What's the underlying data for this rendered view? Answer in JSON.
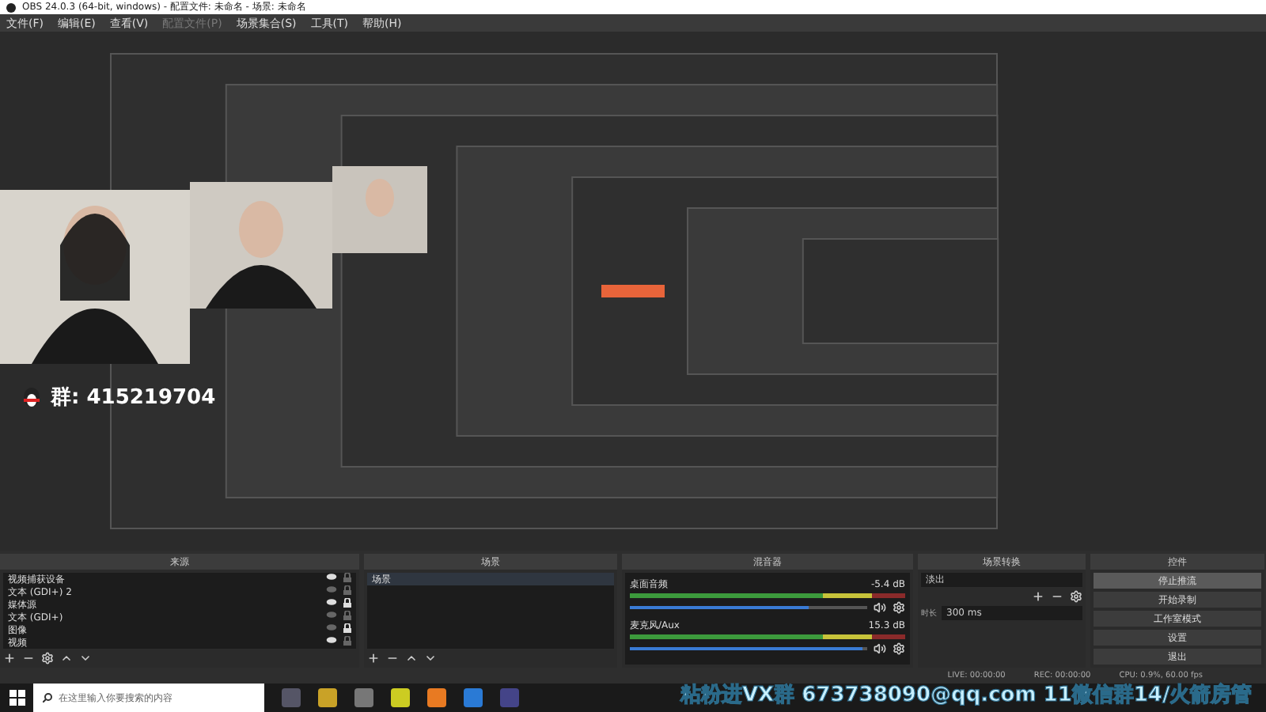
{
  "window": {
    "title": "OBS 24.0.3 (64-bit, windows) - 配置文件: 未命名 - 场景: 未命名"
  },
  "menu": [
    {
      "label": "文件(F)",
      "disabled": false
    },
    {
      "label": "编辑(E)",
      "disabled": false
    },
    {
      "label": "查看(V)",
      "disabled": false
    },
    {
      "label": "配置文件(P)",
      "disabled": true
    },
    {
      "label": "场景集合(S)",
      "disabled": false
    },
    {
      "label": "工具(T)",
      "disabled": false
    },
    {
      "label": "帮助(H)",
      "disabled": false
    }
  ],
  "preview": {
    "group_label": "群: 415219704"
  },
  "overlay_text": "粘粉进VX群 673738090@qq.com 11微信群14/火箭房管",
  "sources": {
    "title": "来源",
    "items": [
      {
        "name": "视频捕获设备",
        "visible": true,
        "locked": false
      },
      {
        "name": "文本 (GDI+) 2",
        "visible": false,
        "locked": false
      },
      {
        "name": "媒体源",
        "visible": true,
        "locked": true
      },
      {
        "name": "文本 (GDI+)",
        "visible": false,
        "locked": false
      },
      {
        "name": "图像",
        "visible": false,
        "locked": true
      },
      {
        "name": "视频",
        "visible": true,
        "locked": false
      }
    ]
  },
  "scenes": {
    "title": "场景",
    "items": [
      {
        "name": "场景",
        "selected": true
      }
    ]
  },
  "mixer": {
    "title": "混音器",
    "channels": [
      {
        "name": "桌面音频",
        "reading": "-5.4 dB",
        "level": 0.75
      },
      {
        "name": "麦克风/Aux",
        "reading": "15.3 dB",
        "level": 0.98
      }
    ]
  },
  "transitions": {
    "title": "场景转换",
    "selected": "淡出",
    "duration_label": "时长",
    "duration": "300 ms"
  },
  "controls": {
    "title": "控件",
    "buttons": [
      {
        "label": "停止推流",
        "selected": true
      },
      {
        "label": "开始录制",
        "selected": false
      },
      {
        "label": "工作室模式",
        "selected": false
      },
      {
        "label": "设置",
        "selected": false
      },
      {
        "label": "退出",
        "selected": false
      }
    ]
  },
  "status_bar": [
    "LIVE: 00:00:00",
    "REC: 00:00:00",
    "CPU: 0.9%, 60.00 fps"
  ],
  "taskbar": {
    "search_placeholder": "在这里输入你要搜索的内容"
  }
}
